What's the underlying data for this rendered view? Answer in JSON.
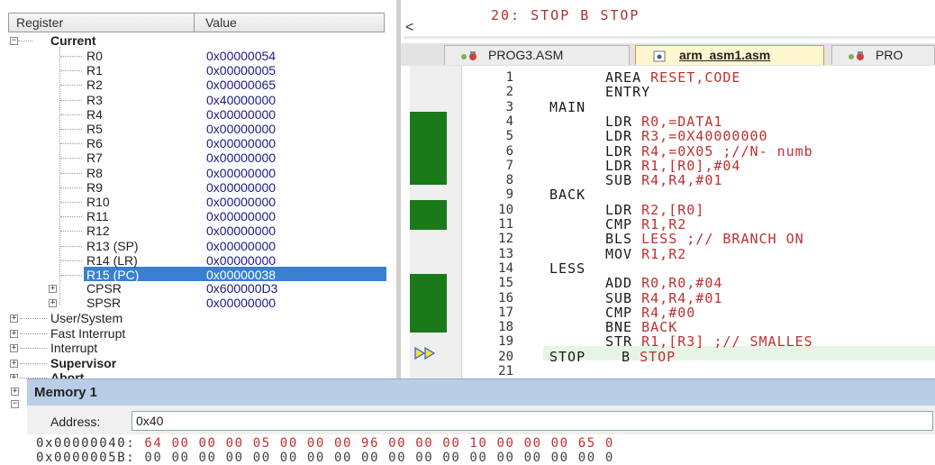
{
  "registers": {
    "header": {
      "col_register": "Register",
      "col_value": "Value"
    },
    "current_label": "Current",
    "items": [
      {
        "name": "R0",
        "value": "0x00000054"
      },
      {
        "name": "R1",
        "value": "0x00000005"
      },
      {
        "name": "R2",
        "value": "0x00000065"
      },
      {
        "name": "R3",
        "value": "0x40000000"
      },
      {
        "name": "R4",
        "value": "0x00000000"
      },
      {
        "name": "R5",
        "value": "0x00000000"
      },
      {
        "name": "R6",
        "value": "0x00000000"
      },
      {
        "name": "R7",
        "value": "0x00000000"
      },
      {
        "name": "R8",
        "value": "0x00000000"
      },
      {
        "name": "R9",
        "value": "0x00000000"
      },
      {
        "name": "R10",
        "value": "0x00000000"
      },
      {
        "name": "R11",
        "value": "0x00000000"
      },
      {
        "name": "R12",
        "value": "0x00000000"
      },
      {
        "name": "R13 (SP)",
        "value": "0x00000000"
      },
      {
        "name": "R14 (LR)",
        "value": "0x00000000"
      },
      {
        "name": "R15 (PC)",
        "value": "0x00000038"
      }
    ],
    "cpsr": {
      "name": "CPSR",
      "value": "0x600000D3"
    },
    "spsr": {
      "name": "SPSR",
      "value": "0x00000000"
    },
    "groups": [
      "User/System",
      "Fast Interrupt",
      "Interrupt",
      "Supervisor",
      "Abort"
    ]
  },
  "editor": {
    "top_line": "20: STOP B STOP",
    "scroll_left": "<",
    "tabs": [
      "PROG3.ASM",
      "arm_asm1.asm",
      "PRO"
    ],
    "lines": [
      {
        "n": "1",
        "label": "",
        "op": "AREA",
        "args": "RESET,CODE"
      },
      {
        "n": "2",
        "label": "",
        "op": "ENTRY",
        "args": ""
      },
      {
        "n": "3",
        "label": "MAIN",
        "op": "",
        "args": ""
      },
      {
        "n": "4",
        "label": "",
        "op": "LDR",
        "args": "R0,=DATA1"
      },
      {
        "n": "5",
        "label": "",
        "op": "LDR",
        "args": "R3,=0X40000000"
      },
      {
        "n": "6",
        "label": "",
        "op": "LDR",
        "args": "R4,=0X05 ;//N- numb"
      },
      {
        "n": "7",
        "label": "",
        "op": "LDR",
        "args": "R1,[R0],#04"
      },
      {
        "n": "8",
        "label": "",
        "op": "SUB",
        "args": "R4,R4,#01"
      },
      {
        "n": "9",
        "label": "BACK",
        "op": "",
        "args": ""
      },
      {
        "n": "10",
        "label": "",
        "op": "LDR",
        "args": "R2,[R0]"
      },
      {
        "n": "11",
        "label": "",
        "op": "CMP",
        "args": "R1,R2"
      },
      {
        "n": "12",
        "label": "",
        "op": "BLS",
        "args": "LESS ;// BRANCH ON"
      },
      {
        "n": "13",
        "label": "",
        "op": "MOV",
        "args": "R1,R2"
      },
      {
        "n": "14",
        "label": "LESS",
        "op": "",
        "args": ""
      },
      {
        "n": "15",
        "label": "",
        "op": "ADD",
        "args": "R0,R0,#04"
      },
      {
        "n": "16",
        "label": "",
        "op": "SUB",
        "args": "R4,R4,#01"
      },
      {
        "n": "17",
        "label": "",
        "op": "CMP",
        "args": "R4,#00"
      },
      {
        "n": "18",
        "label": "",
        "op": "BNE",
        "args": "BACK"
      },
      {
        "n": "19",
        "label": "",
        "op": "STR",
        "args": "R1,[R3] ;// SMALLES"
      },
      {
        "n": "20",
        "label": "STOP",
        "op": "B",
        "args": "STOP"
      },
      {
        "n": "21",
        "label": "",
        "op": "",
        "args": ""
      }
    ]
  },
  "memory": {
    "title": "Memory 1",
    "address_label": "Address:",
    "address_value": "0x40",
    "rows": [
      {
        "addr": "0x00000040:",
        "bytes": "64 00 00 00 05 00 00 00 96 00 00 00 10 00 00 00 65 0"
      },
      {
        "addr": "0x0000005B:",
        "bytes": "00 00 00 00 00 00 00 00 00 00 00 00 00 00 00 00 00 0"
      }
    ]
  },
  "colors": {
    "coverage": "#1a7a1a",
    "highlight": "#3a80d0",
    "mem_title_bar": "#b9cde6"
  }
}
